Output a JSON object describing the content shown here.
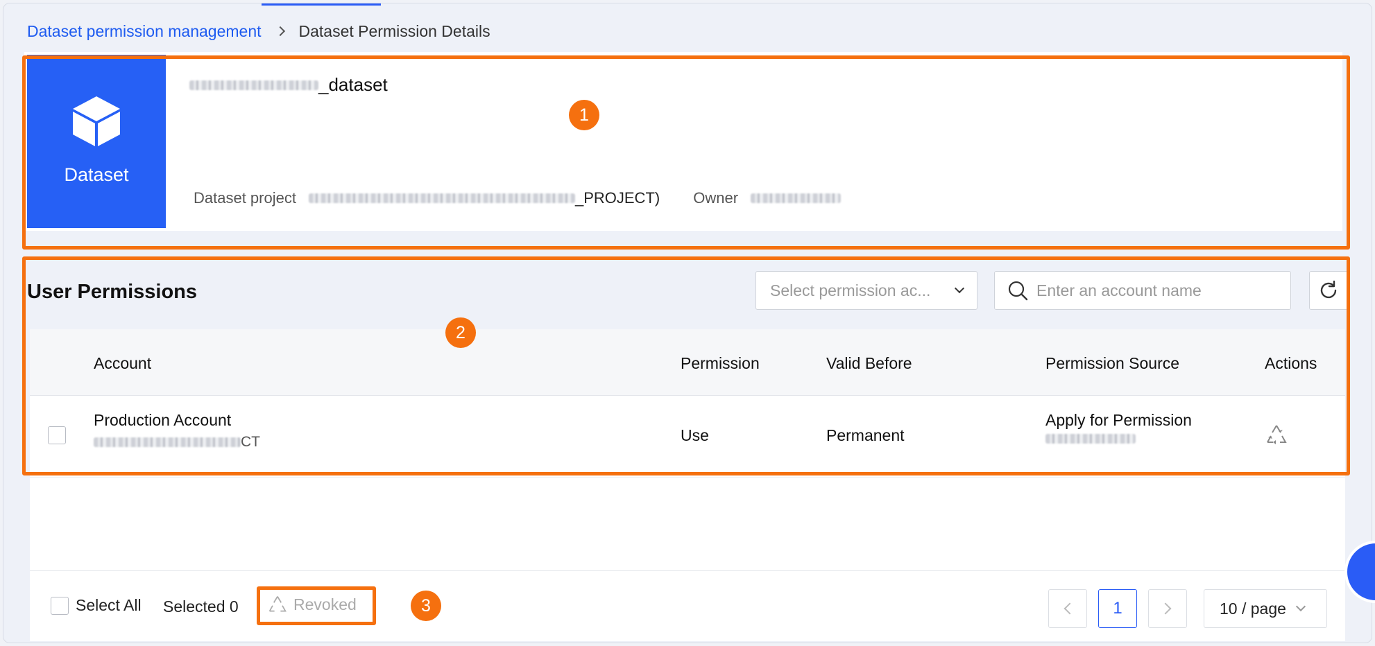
{
  "breadcrumb": {
    "parent": "Dataset permission management",
    "current": "Dataset Permission Details"
  },
  "dataset": {
    "tile_label": "Dataset",
    "name_suffix": "_dataset",
    "project_label": "Dataset project",
    "project_suffix": "_PROJECT)",
    "owner_label": "Owner"
  },
  "permissions": {
    "title": "User Permissions",
    "filter_placeholder": "Select permission ac...",
    "search_placeholder": "Enter an account name",
    "columns": [
      "Account",
      "Permission",
      "Valid Before",
      "Permission Source",
      "Actions"
    ],
    "rows": [
      {
        "account": "Production Account",
        "account_sub_suffix": "CT",
        "permission": "Use",
        "valid_before": "Permanent",
        "source": "Apply for Permission"
      }
    ]
  },
  "footer": {
    "select_all": "Select All",
    "selected": "Selected 0",
    "revoke": "Revoked",
    "page": "1",
    "page_size": "10 / page"
  },
  "annotations": [
    "1",
    "2",
    "3"
  ],
  "colors": {
    "accent": "#2660f5",
    "annotation": "#f5700f",
    "link": "#1e5bf0"
  }
}
